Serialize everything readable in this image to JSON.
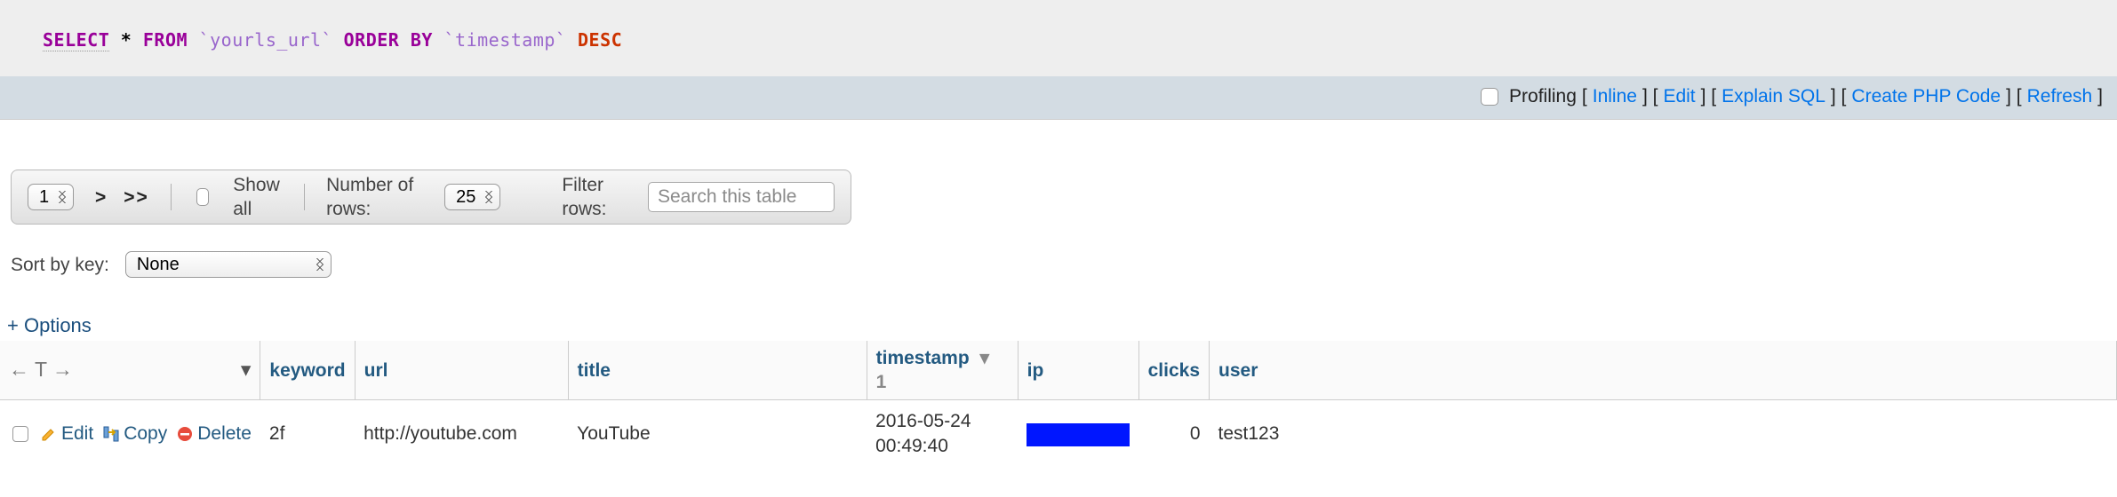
{
  "sql": {
    "kw_select": "SELECT",
    "star": " * ",
    "kw_from": "FROM",
    "table": "`yourls_url`",
    "kw_order": "ORDER BY",
    "col": "`timestamp`",
    "dir": "DESC"
  },
  "profiling": {
    "label": "Profiling",
    "links": {
      "inline": "Inline",
      "edit": "Edit",
      "explain": "Explain SQL",
      "create_php": "Create PHP Code",
      "refresh": "Refresh"
    }
  },
  "toolbar": {
    "page_value": "1",
    "nav_next": ">",
    "nav_last": ">>",
    "show_all": "Show all",
    "rows_label": "Number of rows:",
    "rows_value": "25",
    "filter_label": "Filter rows:",
    "filter_placeholder": "Search this table"
  },
  "sort_by_key": {
    "label": "Sort by key:",
    "value": "None"
  },
  "options_label": "Options",
  "table": {
    "corner": {
      "left_arrow": "←",
      "t": "T",
      "right_arrow": "→",
      "caret": "▾"
    },
    "sort_index": "1",
    "columns": {
      "keyword": "keyword",
      "url": "url",
      "title": "title",
      "timestamp": "timestamp",
      "ip": "ip",
      "clicks": "clicks",
      "user": "user"
    },
    "row_actions": {
      "edit": "Edit",
      "copy": "Copy",
      "delete": "Delete"
    },
    "rows": [
      {
        "keyword": "2f",
        "url": "http://youtube.com",
        "title": "YouTube",
        "timestamp": "2016-05-24 00:49:40",
        "ip": "",
        "clicks": "0",
        "user": "test123"
      }
    ]
  }
}
